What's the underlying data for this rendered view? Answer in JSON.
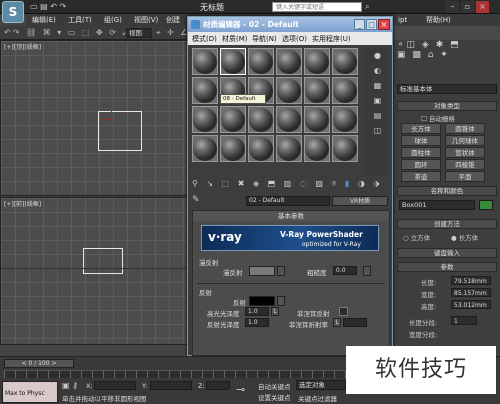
{
  "app": {
    "title": "无标题",
    "search_placeholder": "键入关键字或短语"
  },
  "menubar": {
    "items": [
      "编辑(E)",
      "工具(T)",
      "组(G)",
      "视图(V)",
      "创建",
      "ipt",
      "帮助(H)"
    ],
    "view_select": "视图"
  },
  "viewports": {
    "top_left_label": "[+][顶][线框]",
    "bottom_left_label": "[+][前][线框]"
  },
  "material_editor": {
    "title": "材质编辑器 - 02 - Default",
    "menus": [
      "模式(D)",
      "材质(M)",
      "导航(N)",
      "选项(O)",
      "实用程序(U)"
    ],
    "tooltip": "08 - Default",
    "material_name": "02 - Default",
    "material_type": "VR材质",
    "rollout_title": "基本参数",
    "vray_logo": "v·ray",
    "vray_heading": "V-Ray PowerShader",
    "vray_sub": "optimized for V-Ray",
    "diffuse_group": "漫反射",
    "diffuse_label": "漫反射",
    "roughness_label": "粗糙度",
    "roughness_value": "0.0",
    "reflection_group": "反射",
    "reflect_label": "反射",
    "highlight_gloss_label": "高光光泽度",
    "highlight_gloss_value": "1.0",
    "reflect_gloss_label": "反射光泽度",
    "reflect_gloss_value": "1.0",
    "fresnel_label": "菲涅耳反射",
    "fresnel_ior_label": "菲涅耳折射率",
    "l_button": "L",
    "m_button": "M"
  },
  "command_panel": {
    "category": "标准基本体",
    "object_type_hdr": "对象类型",
    "autogrid": "自动栅格",
    "buttons": [
      "长方体",
      "圆锥体",
      "球体",
      "几何球体",
      "圆柱体",
      "管状体",
      "圆环",
      "四棱锥",
      "茶壶",
      "平面"
    ],
    "name_color_hdr": "名称和颜色",
    "object_name": "Box001",
    "creation_hdr": "创建方法",
    "creation_cube": "立方体",
    "creation_box": "长方体",
    "keyboard_hdr": "键盘输入",
    "params_hdr": "参数",
    "length_label": "长度:",
    "length_value": "79.518mm",
    "width_label": "宽度:",
    "width_value": "85.157mm",
    "height_label": "高度:",
    "height_value": "53.012mm",
    "length_segs_label": "长度分段:",
    "length_segs_value": "1",
    "width_segs_label": "宽度分段:"
  },
  "timeline": {
    "frame": "0 / 100",
    "x_label": "X:",
    "y_label": "Y:",
    "z_label": "Z:",
    "autokey": "自动关键点",
    "selected": "选定对象",
    "setkey": "设置关键点",
    "keyfilter": "关键点过滤器",
    "status": "单击并拖动以平移非圆形视图",
    "maxscript": "Max to Physc"
  },
  "watermark": "软件技巧"
}
